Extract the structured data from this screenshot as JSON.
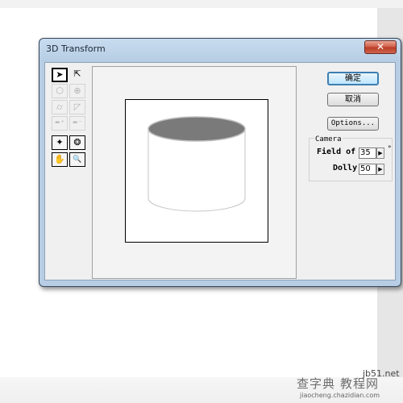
{
  "dialog": {
    "title": "3D Transform",
    "close_glyph": "✕"
  },
  "tools": [
    {
      "name": "selection-arrow-icon",
      "glyph": "➤"
    },
    {
      "name": "direct-select-arrow-icon",
      "glyph": "⇱"
    },
    {
      "name": "cube-icon",
      "glyph": "⬡"
    },
    {
      "name": "globe-icon",
      "glyph": "⊕"
    },
    {
      "name": "cylinder-icon",
      "glyph": "⌭"
    },
    {
      "name": "cone-icon",
      "glyph": "◸"
    },
    {
      "name": "add-anchor-icon",
      "glyph": "✒⁺"
    },
    {
      "name": "remove-anchor-icon",
      "glyph": "✒⁻"
    },
    {
      "name": "light-icon",
      "glyph": "✦"
    },
    {
      "name": "rotate-camera-icon",
      "glyph": "❂"
    },
    {
      "name": "hand-icon",
      "glyph": "✋"
    },
    {
      "name": "magnifier-icon",
      "glyph": "🔍"
    }
  ],
  "buttons": {
    "ok": "确定",
    "cancel": "取消",
    "options": "Options..."
  },
  "camera": {
    "group_label": "Camera",
    "field_of_view_label": "Field of",
    "field_of_view_value": "35",
    "field_of_view_unit": "°",
    "dolly_label": "Dolly:",
    "dolly_value": "50"
  },
  "watermark": {
    "line1": "查字典",
    "line2": "教程网",
    "site": "jb51.net",
    "url": "jiaocheng.chazidian.com"
  },
  "colors": {
    "cylinder_top": "#7a7a7a",
    "cylinder_outline": "#bdbdbd",
    "accent": "#3c7fb1"
  }
}
